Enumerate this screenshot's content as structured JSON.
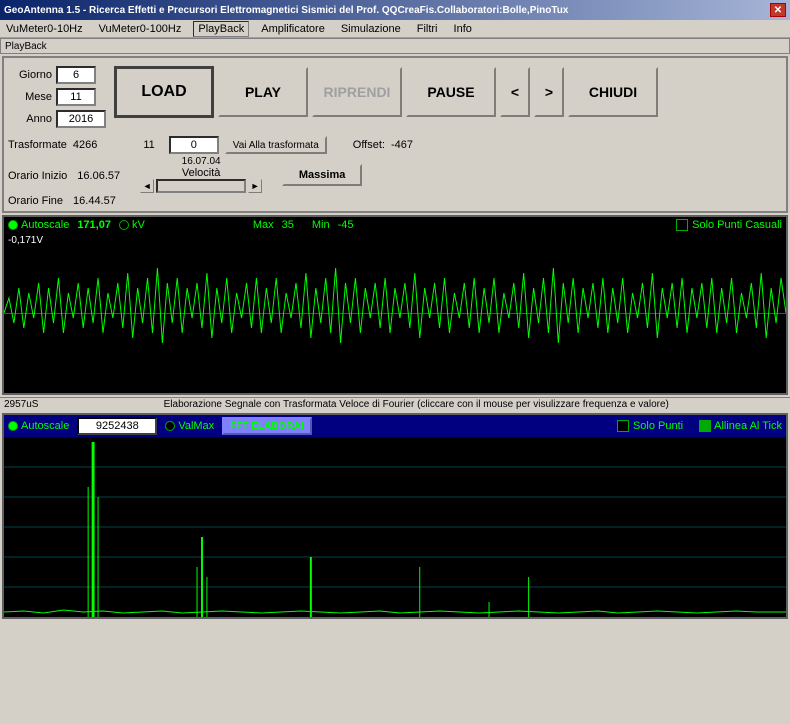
{
  "window": {
    "title": "GeoAntenna 1.5 - Ricerca Effetti e Precursori Elettromagnetici Sismici del Prof. QQCreaFis.Collaboratori:Bolle,PinoTux"
  },
  "menu": {
    "items": [
      {
        "label": "VuMeter0-10Hz"
      },
      {
        "label": "VuMeter0-100Hz"
      },
      {
        "label": "PlayBack"
      },
      {
        "label": "Amplificatore"
      },
      {
        "label": "Simulazione"
      },
      {
        "label": "Filtri"
      },
      {
        "label": "Info"
      }
    ]
  },
  "playback_label": "PlayBack",
  "controls": {
    "giorno_label": "Giorno",
    "mese_label": "Mese",
    "anno_label": "Anno",
    "giorno_val": "6",
    "mese_val": "11",
    "anno_val": "2016",
    "load": "LOAD",
    "play": "PLAY",
    "riprendi": "RIPRENDI",
    "pause": "PAUSE",
    "prev": "<",
    "next": ">",
    "chiudi": "CHIUDI"
  },
  "info": {
    "trasformate_label": "Trasformate",
    "trasformate_val": "4266",
    "transform_num": "11",
    "transform_input": "0",
    "vai_btn": "Vai Alla trasformata",
    "offset_label": "Offset:",
    "offset_val": "-467",
    "orario_inizio_label": "Orario Inizio",
    "orario_inizio_val": "16.06.57",
    "orario_fine_label": "Orario Fine",
    "orario_fine_val": "16.44.57",
    "velocita_label": "16.07.04",
    "velocita_sub": "Velocità",
    "massima_btn": "Massima"
  },
  "waveform": {
    "autoscale_label": "Autoscale",
    "value": "171,07",
    "unit": "kV",
    "max_label": "Max",
    "max_val": "35",
    "min_label": "Min",
    "min_val": "-45",
    "solo_punti": "Solo Punti Casuali",
    "voltage": "-0,171V"
  },
  "status": {
    "time": "2957uS",
    "message": "Elaborazione Segnale con Trasformata Veloce di Fourier (cliccare con il mouse per visulizzare frequenza e valore)"
  },
  "fft": {
    "autoscale_label": "Autoscale",
    "value_input": "9252438",
    "val_max_label": "ValMax",
    "elabora_btn": "FFT ELABORA!",
    "solo_punti": "Solo Punti",
    "allinea_label": "Allinea Al Tick"
  }
}
